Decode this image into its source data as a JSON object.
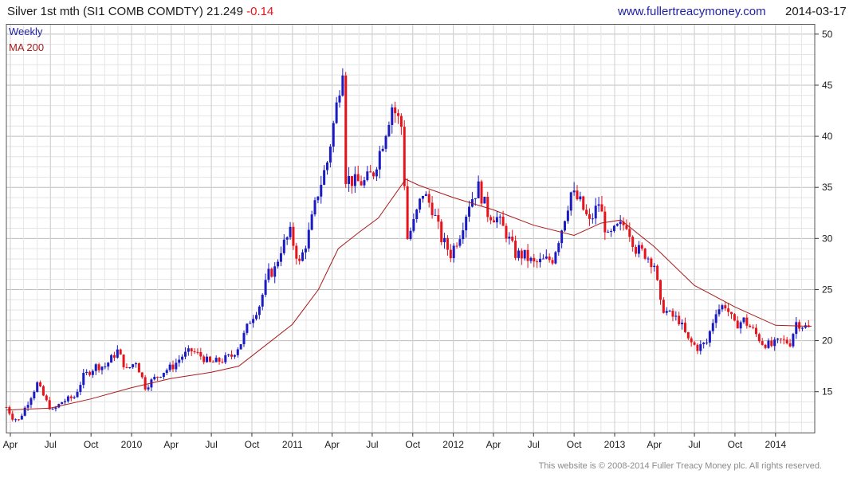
{
  "header": {
    "title": "Silver 1st mth (SI1 COMB COMDTY) 21.249",
    "change": "-0.14",
    "website": "www.fullertreacymoney.com",
    "date": "2014-03-17"
  },
  "legend": {
    "period": "Weekly",
    "ma": "MA 200"
  },
  "footer": "This website is © 2008-2014 Fuller Treacy Money plc. All rights reserved.",
  "colors": {
    "up": "#1b1bc4",
    "down": "#e8131a",
    "ma": "#a81b1b",
    "grid": "#d2d2d2",
    "text": "#1a1a1a"
  },
  "chart_data": {
    "type": "candlestick",
    "ylim": [
      11,
      51
    ],
    "yticks": [
      15,
      20,
      25,
      30,
      35,
      40,
      45,
      50
    ],
    "x_tick_labels": [
      "Apr",
      "Jul",
      "Oct",
      "2010",
      "Apr",
      "Jul",
      "Oct",
      "2011",
      "Apr",
      "Jul",
      "Oct",
      "2012",
      "Apr",
      "Jul",
      "Oct",
      "2013",
      "Apr",
      "Jul",
      "Oct",
      "2014"
    ],
    "x_tick_dates": [
      "2009-04-01",
      "2009-07-01",
      "2009-10-01",
      "2010-01-01",
      "2010-04-01",
      "2010-07-01",
      "2010-10-01",
      "2011-01-01",
      "2011-04-01",
      "2011-07-01",
      "2011-10-01",
      "2012-01-01",
      "2012-04-01",
      "2012-07-01",
      "2012-10-01",
      "2013-01-01",
      "2013-04-01",
      "2013-07-01",
      "2013-10-01",
      "2014-01-01"
    ],
    "x_range": [
      "2009-03-23",
      "2014-03-31"
    ],
    "close_points": [
      [
        "2009-03-23",
        13.5
      ],
      [
        "2009-04-06",
        12.5
      ],
      [
        "2009-04-20",
        12.2
      ],
      [
        "2009-05-11",
        14.0
      ],
      [
        "2009-06-01",
        15.8
      ],
      [
        "2009-06-22",
        14.0
      ],
      [
        "2009-07-06",
        13.1
      ],
      [
        "2009-07-27",
        14.0
      ],
      [
        "2009-08-24",
        14.5
      ],
      [
        "2009-09-14",
        16.5
      ],
      [
        "2009-10-12",
        17.5
      ],
      [
        "2009-11-02",
        17.5
      ],
      [
        "2009-11-30",
        19.0
      ],
      [
        "2009-12-21",
        17.1
      ],
      [
        "2010-01-11",
        18.0
      ],
      [
        "2010-02-01",
        15.5
      ],
      [
        "2010-02-22",
        16.3
      ],
      [
        "2010-03-15",
        17.0
      ],
      [
        "2010-04-05",
        17.5
      ],
      [
        "2010-04-26",
        18.5
      ],
      [
        "2010-05-17",
        19.0
      ],
      [
        "2010-06-07",
        18.5
      ],
      [
        "2010-06-28",
        17.8
      ],
      [
        "2010-07-26",
        18.1
      ],
      [
        "2010-08-16",
        18.5
      ],
      [
        "2010-09-06",
        19.8
      ],
      [
        "2010-09-27",
        22.0
      ],
      [
        "2010-10-18",
        23.5
      ],
      [
        "2010-11-08",
        26.5
      ],
      [
        "2010-11-22",
        27.0
      ],
      [
        "2010-12-06",
        29.0
      ],
      [
        "2010-12-27",
        30.5
      ],
      [
        "2011-01-17",
        27.5
      ],
      [
        "2011-02-07",
        30.5
      ],
      [
        "2011-02-28",
        34.5
      ],
      [
        "2011-03-21",
        37.5
      ],
      [
        "2011-04-11",
        43.0
      ],
      [
        "2011-04-25",
        47.0
      ],
      [
        "2011-05-02",
        36.0
      ],
      [
        "2011-05-23",
        35.5
      ],
      [
        "2011-06-13",
        35.5
      ],
      [
        "2011-07-04",
        36.5
      ],
      [
        "2011-07-25",
        39.5
      ],
      [
        "2011-08-15",
        43.0
      ],
      [
        "2011-09-05",
        41.0
      ],
      [
        "2011-09-19",
        30.0
      ],
      [
        "2011-10-03",
        31.5
      ],
      [
        "2011-10-24",
        34.5
      ],
      [
        "2011-11-14",
        33.0
      ],
      [
        "2011-12-05",
        30.0
      ],
      [
        "2011-12-26",
        28.5
      ],
      [
        "2012-01-16",
        30.5
      ],
      [
        "2012-02-06",
        33.5
      ],
      [
        "2012-02-27",
        35.0
      ],
      [
        "2012-03-19",
        32.5
      ],
      [
        "2012-04-09",
        32.0
      ],
      [
        "2012-04-30",
        30.5
      ],
      [
        "2012-05-21",
        28.5
      ],
      [
        "2012-06-11",
        28.3
      ],
      [
        "2012-07-02",
        27.5
      ],
      [
        "2012-07-23",
        27.8
      ],
      [
        "2012-08-13",
        28.0
      ],
      [
        "2012-09-03",
        31.0
      ],
      [
        "2012-09-24",
        34.5
      ],
      [
        "2012-10-15",
        33.5
      ],
      [
        "2012-11-05",
        31.5
      ],
      [
        "2012-11-26",
        33.5
      ],
      [
        "2012-12-17",
        30.0
      ],
      [
        "2013-01-07",
        31.0
      ],
      [
        "2013-01-28",
        31.5
      ],
      [
        "2013-02-18",
        29.0
      ],
      [
        "2013-03-11",
        28.5
      ],
      [
        "2013-04-01",
        27.5
      ],
      [
        "2013-04-15",
        23.5
      ],
      [
        "2013-05-06",
        22.5
      ],
      [
        "2013-05-27",
        22.0
      ],
      [
        "2013-06-17",
        20.0
      ],
      [
        "2013-07-08",
        19.3
      ],
      [
        "2013-07-29",
        19.8
      ],
      [
        "2013-08-19",
        23.0
      ],
      [
        "2013-09-09",
        23.5
      ],
      [
        "2013-09-30",
        21.5
      ],
      [
        "2013-10-21",
        22.0
      ],
      [
        "2013-11-11",
        21.0
      ],
      [
        "2013-12-02",
        19.8
      ],
      [
        "2013-12-23",
        19.5
      ],
      [
        "2014-01-13",
        20.0
      ],
      [
        "2014-02-03",
        19.8
      ],
      [
        "2014-02-17",
        21.8
      ],
      [
        "2014-03-03",
        21.5
      ],
      [
        "2014-03-17",
        21.2
      ]
    ],
    "ma200_points": [
      [
        "2009-03-23",
        13.2
      ],
      [
        "2009-07-01",
        13.4
      ],
      [
        "2009-10-01",
        14.3
      ],
      [
        "2010-01-01",
        15.4
      ],
      [
        "2010-04-01",
        16.3
      ],
      [
        "2010-07-01",
        16.9
      ],
      [
        "2010-09-01",
        17.5
      ],
      [
        "2010-10-01",
        18.5
      ],
      [
        "2011-01-01",
        21.6
      ],
      [
        "2011-03-01",
        25.0
      ],
      [
        "2011-04-15",
        29.0
      ],
      [
        "2011-06-01",
        30.6
      ],
      [
        "2011-07-15",
        32.0
      ],
      [
        "2011-09-15",
        35.8
      ],
      [
        "2011-10-15",
        35.2
      ],
      [
        "2012-01-01",
        34.0
      ],
      [
        "2012-04-01",
        32.8
      ],
      [
        "2012-07-01",
        31.3
      ],
      [
        "2012-10-01",
        30.3
      ],
      [
        "2012-12-01",
        31.5
      ],
      [
        "2013-01-15",
        31.8
      ],
      [
        "2013-04-01",
        29.2
      ],
      [
        "2013-07-01",
        25.4
      ],
      [
        "2013-10-01",
        23.3
      ],
      [
        "2014-01-01",
        21.5
      ],
      [
        "2014-03-24",
        21.4
      ]
    ]
  }
}
